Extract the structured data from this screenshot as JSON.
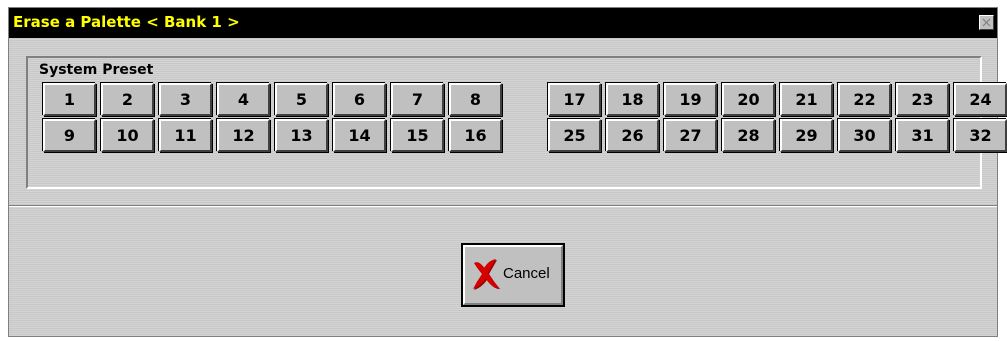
{
  "window": {
    "title": "Erase a Palette < Bank 1 >",
    "title_color": "#ffff00",
    "titlebar_color": "#000000"
  },
  "preset_group": {
    "label": "System Preset",
    "rows": [
      {
        "left": [
          "1",
          "2",
          "3",
          "4",
          "5",
          "6",
          "7",
          "8"
        ],
        "right": [
          "17",
          "18",
          "19",
          "20",
          "21",
          "22",
          "23",
          "24"
        ]
      },
      {
        "left": [
          "9",
          "10",
          "11",
          "12",
          "13",
          "14",
          "15",
          "16"
        ],
        "right": [
          "25",
          "26",
          "27",
          "28",
          "29",
          "30",
          "31",
          "32"
        ]
      }
    ]
  },
  "cancel_button": {
    "label": "Cancel",
    "icon": "red-x-icon",
    "icon_color": "#cc0000"
  },
  "close_button": {
    "icon": "close-icon"
  }
}
